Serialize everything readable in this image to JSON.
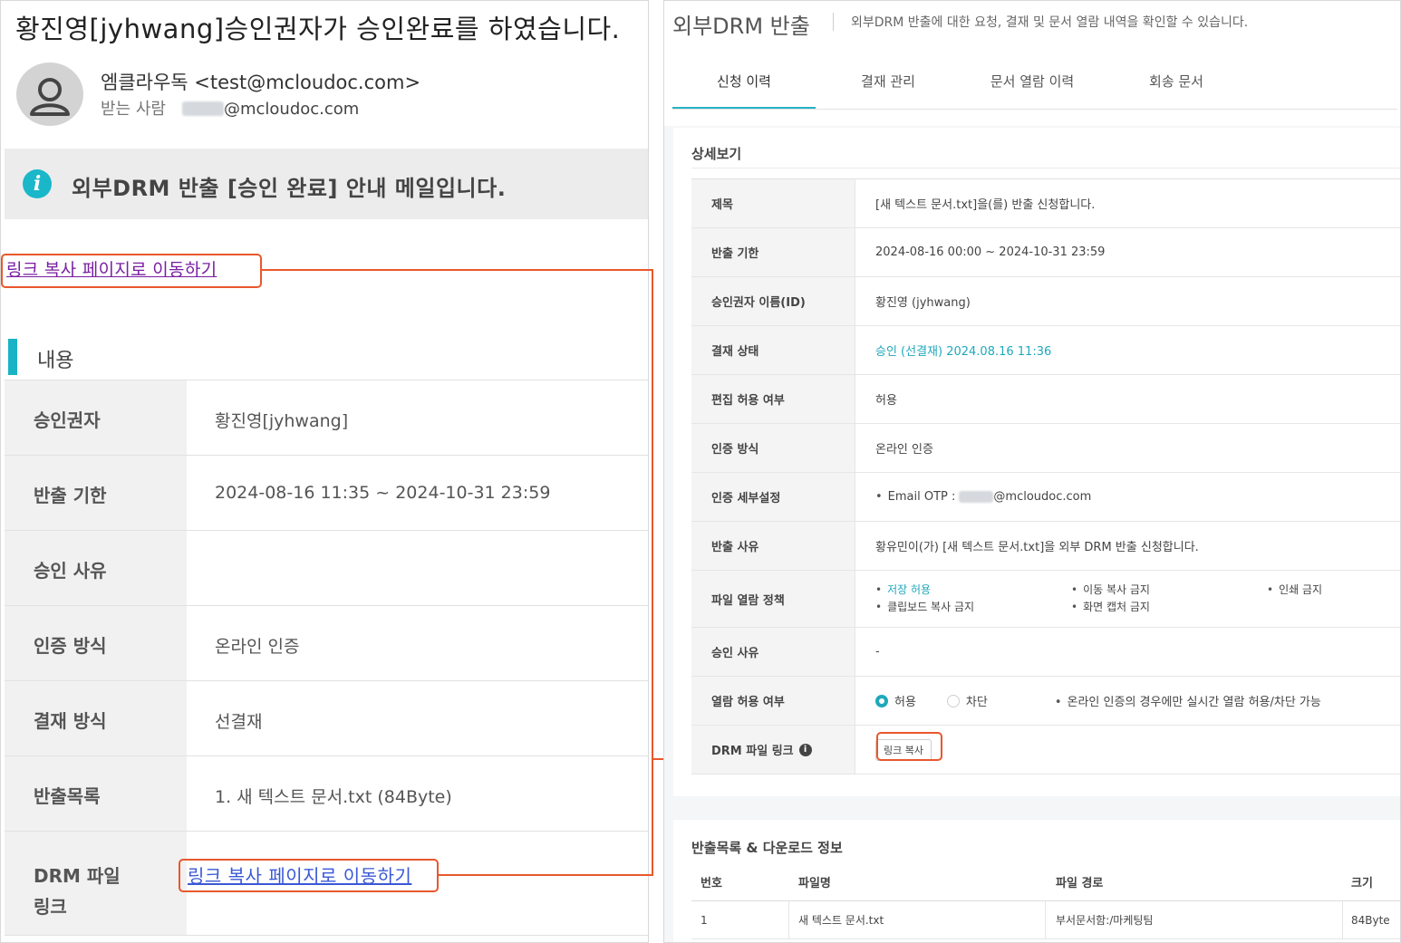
{
  "email": {
    "subject": "황진영[jyhwang]승인권자가 승인완료를 하였습니다.",
    "sender": "엠클라우독 <test@mcloudoc.com>",
    "recipient_label": "받는 사람",
    "recipient_domain": "@mcloudoc.com",
    "notice": "외부DRM 반출 [승인 완료] 안내 메일입니다.",
    "link_top": "링크 복사 페이지로 이동하기",
    "section_title": "내용",
    "rows": [
      {
        "label": "승인권자",
        "value": "황진영[jyhwang]"
      },
      {
        "label": "반출 기한",
        "value": "2024-08-16 11:35 ~ 2024-10-31 23:59"
      },
      {
        "label": "승인 사유",
        "value": ""
      },
      {
        "label": "인증 방식",
        "value": "온라인 인증"
      },
      {
        "label": "결재 방식",
        "value": "선결재"
      },
      {
        "label": "반출목록",
        "value": "1. 새 텍스트 문서.txt (84Byte)"
      }
    ],
    "drm_link_label_1": "DRM 파일",
    "drm_link_label_2": "링크",
    "link_bottom": "링크 복사 페이지로 이동하기"
  },
  "drm": {
    "title": "외부DRM 반출",
    "description": "외부DRM 반출에 대한 요청, 결재 및 문서 열람 내역을 확인할 수 있습니다.",
    "tabs": [
      "신청 이력",
      "결재 관리",
      "문서 열람 이력",
      "회송 문서"
    ],
    "active_tab": "신청 이력",
    "detail_title": "상세보기",
    "details": [
      {
        "label": "제목",
        "value": "[새 텍스트 문서.txt]을(를) 반출 신청합니다."
      },
      {
        "label": "반출 기한",
        "value": "2024-08-16 00:00 ~ 2024-10-31 23:59"
      },
      {
        "label": "승인권자 이름(ID)",
        "value": "황진영 (jyhwang)"
      },
      {
        "label": "결재 상태",
        "value": "승인 (선결재) 2024.08.16 11:36"
      },
      {
        "label": "편집 허용 여부",
        "value": "허용"
      },
      {
        "label": "인증 방식",
        "value": "온라인 인증"
      },
      {
        "label": "인증 세부설정",
        "value": "Email OTP :",
        "value_suffix": "@mcloudoc.com"
      },
      {
        "label": "반출 사유",
        "value": "황유민이(가) [새 텍스트 문서.txt]을 외부 DRM 반출 신청합니다."
      }
    ],
    "policy": {
      "label": "파일 열람 정책",
      "items": [
        "저장 허용",
        "이동 복사 금지",
        "인쇄 금지",
        "클립보드 복사 금지",
        "화면 캡처 금지"
      ]
    },
    "approve_reason": {
      "label": "승인 사유",
      "value": "-"
    },
    "view_allow": {
      "label": "열람 허용 여부",
      "options": [
        "허용",
        "차단"
      ],
      "selected": "허용",
      "note": "온라인 인증의 경우에만 실시간 열람 허용/차단 가능"
    },
    "drm_link": {
      "label": "DRM 파일 링크",
      "button": "링크 복사"
    },
    "files_title": "반출목록 & 다운로드 정보",
    "files_columns": [
      "번호",
      "파일명",
      "파일 경로",
      "크기"
    ],
    "files": [
      {
        "no": "1",
        "name": "새 텍스트 문서.txt",
        "path": "부서문서함:/마케팅팀",
        "size": "84Byte"
      }
    ]
  },
  "colors": {
    "accent": "#1ea9bb",
    "highlight": "#e8582c",
    "visited_link": "#7a1fa2",
    "link": "#3a58d6"
  }
}
